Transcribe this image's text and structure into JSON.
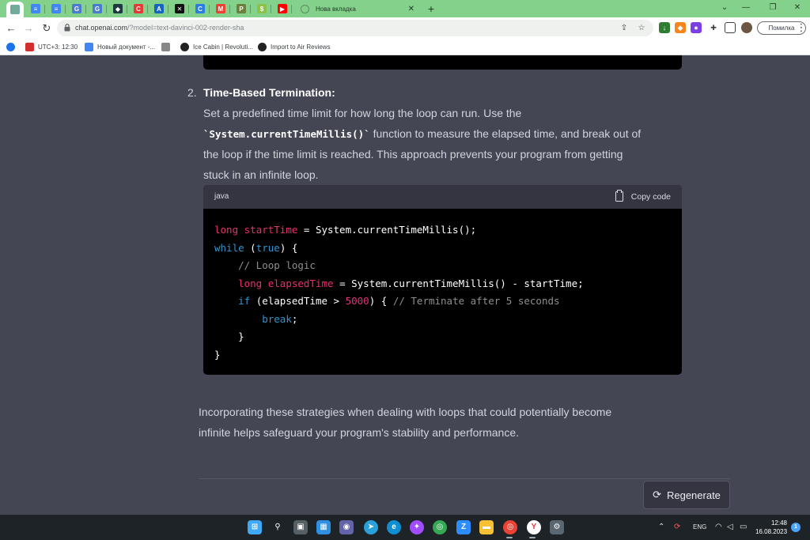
{
  "browser": {
    "tabs_mini": [
      {
        "icon": "chatgpt-icon",
        "color": "#74aa9c",
        "glyph": "",
        "active": true
      },
      {
        "icon": "docs-icon",
        "color": "#4285f4",
        "glyph": "≡"
      },
      {
        "icon": "docs-icon",
        "color": "#4285f4",
        "glyph": "≡"
      },
      {
        "icon": "translate-icon",
        "color": "#4a7bd0",
        "glyph": "G"
      },
      {
        "icon": "translate-icon",
        "color": "#4a7bd0",
        "glyph": "G"
      },
      {
        "icon": "shield-icon",
        "color": "#1e3a40",
        "glyph": "◆"
      },
      {
        "icon": "circle-c-icon",
        "color": "#e53935",
        "glyph": "C"
      },
      {
        "icon": "triangle-a-icon",
        "color": "#1565c0",
        "glyph": "A"
      },
      {
        "icon": "capcut-icon",
        "color": "#111111",
        "glyph": "✕"
      },
      {
        "icon": "c-logo-icon",
        "color": "#2a7de1",
        "glyph": "C"
      },
      {
        "icon": "gmail-icon",
        "color": "#ea4335",
        "glyph": "M"
      },
      {
        "icon": "p-logo-icon",
        "color": "#6b7f3f",
        "glyph": "P"
      },
      {
        "icon": "dollar-icon",
        "color": "#8bc34a",
        "glyph": "$"
      },
      {
        "icon": "youtube-icon",
        "color": "#ff0000",
        "glyph": "▶"
      }
    ],
    "active_tab_title": "Нова вкладка",
    "url_host": "chat.openai.com",
    "url_rest": "/?model=text-davinci-002-render-sha",
    "error_label": "Помилка",
    "bookmarks": [
      {
        "label": "",
        "icon": "apps-icon",
        "color": "#1a73e8"
      },
      {
        "label": "UTC+3: 12:30",
        "icon": "timezone-icon",
        "color": "#d32f2f"
      },
      {
        "label": "Новый документ -...",
        "icon": "docs-icon",
        "color": "#4285f4"
      },
      {
        "label": "",
        "icon": "m-icon",
        "color": "#888888"
      },
      {
        "label": "Ice Cabin | Revoluti...",
        "icon": "github-icon",
        "color": "#222222"
      },
      {
        "label": "Import to Air Reviews",
        "icon": "github-icon",
        "color": "#222222"
      }
    ]
  },
  "chat": {
    "item_number": "2.",
    "item_heading": "Time-Based Termination:",
    "para_line1": "Set a predefined time limit for how long the loop can run. Use the",
    "para_line2_code": "`System.currentTimeMillis()`",
    "para_line2_rest": " function to measure the elapsed time, and break out of",
    "para_line3": "the loop if the time limit is reached. This approach prevents your program from getting",
    "para_line4": "stuck in an infinite loop.",
    "code_lang": "java",
    "copy_label": "Copy code",
    "code": {
      "l1_type": "long",
      "l1_var": "startTime",
      "l1_rest": " = System.currentTimeMillis();",
      "l2_kw": "while",
      "l2_open": " (",
      "l2_val": "true",
      "l2_close": ") {",
      "l3_comment": "// Loop logic",
      "l4_type": "long",
      "l4_var": "elapsedTime",
      "l4_rest": " = System.currentTimeMillis() - startTime;",
      "l5_kw": "if",
      "l5_mid": " (elapsedTime > ",
      "l5_num": "5000",
      "l5_close": ") { ",
      "l5_comment": "// Terminate after 5 seconds",
      "l6_kw": "break",
      "l6_semi": ";",
      "l7": "}",
      "l8": "}"
    },
    "summary_line1": "Incorporating these strategies when dealing with loops that could potentially become",
    "summary_line2": "infinite helps safeguard your program's stability and performance.",
    "regenerate_label": "Regenerate"
  },
  "taskbar": {
    "apps": [
      {
        "icon": "windows-start-icon",
        "color": "#3fa9f5",
        "glyph": "⊞"
      },
      {
        "icon": "search-icon",
        "color": "transparent",
        "glyph": "⚲"
      },
      {
        "icon": "task-view-icon",
        "color": "#555f66",
        "glyph": "▣"
      },
      {
        "icon": "widgets-icon",
        "color": "#2f8fe0",
        "glyph": "▦"
      },
      {
        "icon": "teams-chat-icon",
        "color": "#6264a7",
        "glyph": "◉"
      },
      {
        "icon": "telegram-icon",
        "color": "#2aa1da",
        "glyph": "➤"
      },
      {
        "icon": "edge-icon",
        "color": "#0f8fcf",
        "glyph": "e"
      },
      {
        "icon": "messenger-icon",
        "color": "#a04dff",
        "glyph": "✦"
      },
      {
        "icon": "chrome-icon",
        "color": "#34a853",
        "glyph": "◎"
      },
      {
        "icon": "zoom-icon",
        "color": "#2d8cff",
        "glyph": "Z"
      },
      {
        "icon": "file-explorer-icon",
        "color": "#f5c133",
        "glyph": "▬"
      },
      {
        "icon": "chrome-icon",
        "color": "#ea4335",
        "glyph": "◎"
      },
      {
        "icon": "yandex-icon",
        "color": "#ffffff",
        "glyph": "Y"
      },
      {
        "icon": "settings-icon",
        "color": "#5a6770",
        "glyph": "⚙"
      }
    ],
    "language": "ENG",
    "time": "12:48",
    "date": "16.08.2023",
    "notifications": "1"
  }
}
